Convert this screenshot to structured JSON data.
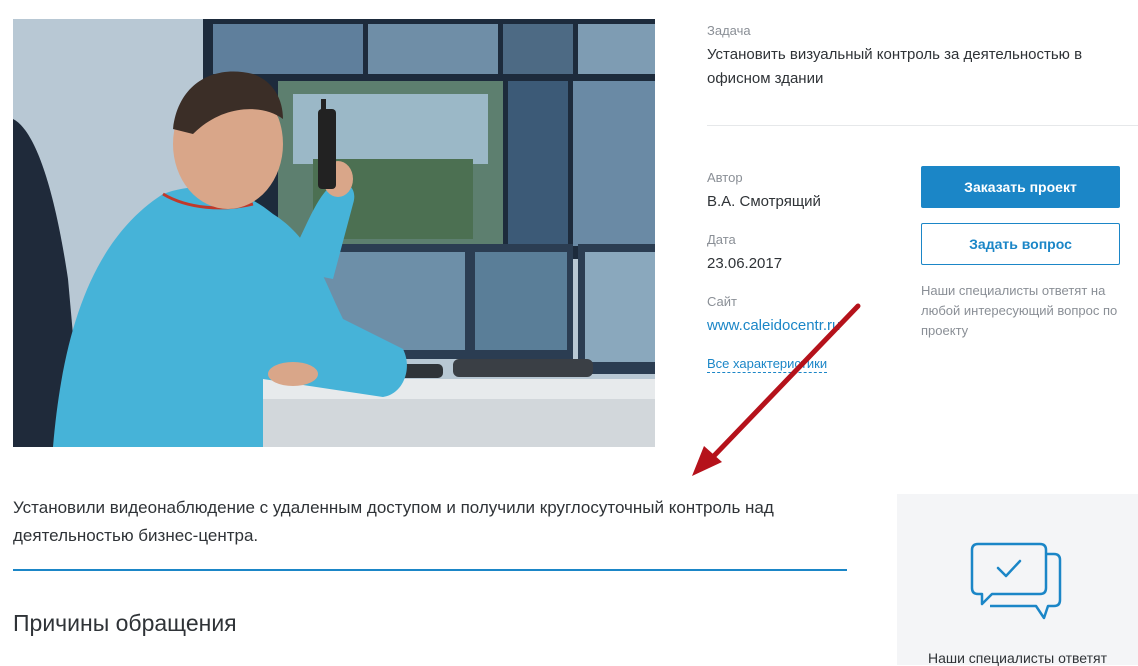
{
  "project": {
    "task_label": "Задача",
    "task_value": "Установить визуальный контроль за деятельностью в офисном здании",
    "author_label": "Автор",
    "author_value": "В.А. Смотрящий",
    "date_label": "Дата",
    "date_value": "23.06.2017",
    "site_label": "Сайт",
    "site_value": "www.caleidocentr.ru",
    "all_characteristics": "Все характеристики"
  },
  "actions": {
    "order_button": "Заказать проект",
    "ask_button": "Задать вопрос",
    "hint": "Наши специалисты ответят на любой интересующий вопрос по проекту"
  },
  "content": {
    "summary": "Установили видеонаблюдение с удаленным доступом и получили круглосуточный контроль над деятельностью бизнес-центра.",
    "section_title": "Причины обращения"
  },
  "aside": {
    "text": "Наши специалисты ответят",
    "icon": "chat-check-icon"
  },
  "colors": {
    "accent": "#1b86c7",
    "arrow": "#b5121b"
  }
}
